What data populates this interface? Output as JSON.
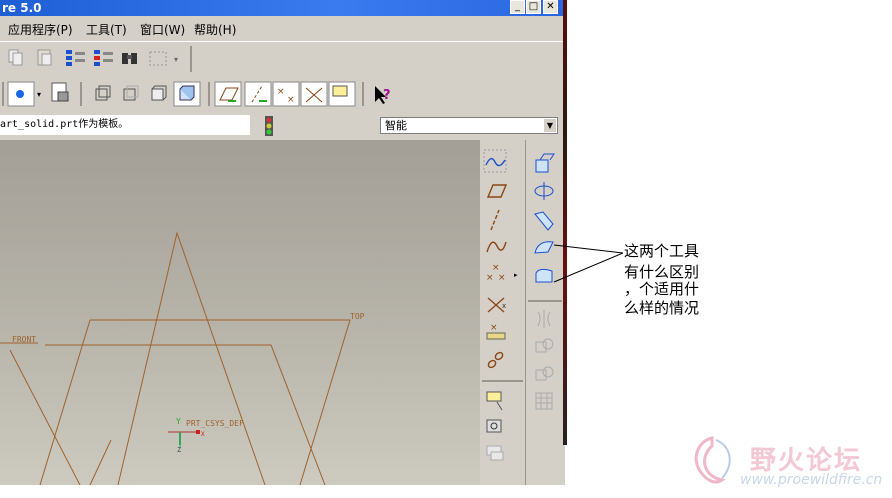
{
  "window": {
    "title": "re 5.0"
  },
  "menu": {
    "items": [
      "应用程序(P)",
      "工具(T)",
      "窗口(W)",
      "帮助(H)"
    ]
  },
  "message": {
    "text": "art_solid.prt作为模板。"
  },
  "filter": {
    "selected": "智能"
  },
  "viewport": {
    "datum_labels": {
      "front": "FRONT",
      "top": "TOP",
      "csys": "PRT_CSYS_DEF"
    },
    "axis_labels": {
      "x": "X",
      "y": "Y",
      "z": "Z"
    }
  },
  "annotation": {
    "lines": [
      "这两个工具",
      "有什么区别",
      "，个适用什",
      "么样的情况"
    ]
  },
  "watermark": {
    "name": "野火论坛",
    "url": "www.proewildfire.cn"
  },
  "colors": {
    "datum": "#a0622b",
    "title_bar": "#2a66e0",
    "chrome": "#d4d0c8"
  }
}
